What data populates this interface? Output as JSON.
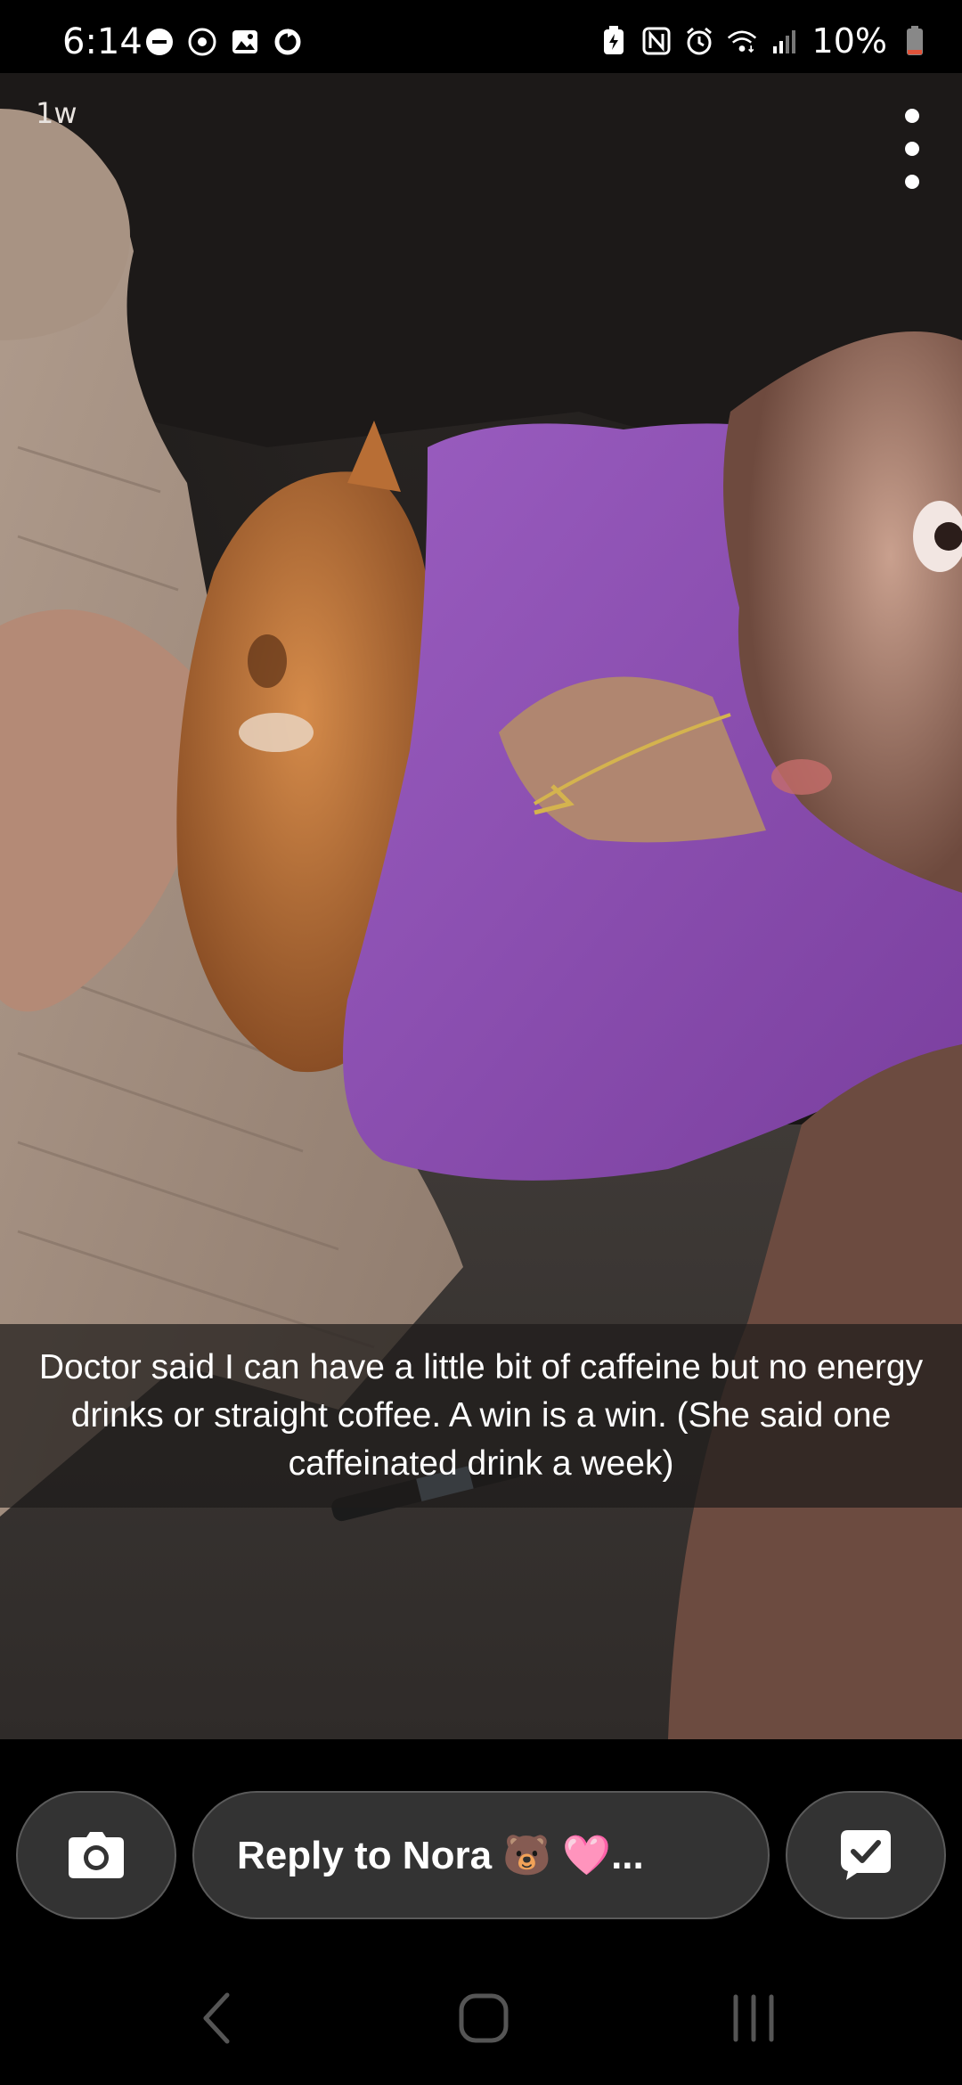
{
  "status_bar": {
    "time": "6:14",
    "battery_percent": "10%",
    "left_icons": [
      "do-not-disturb-icon",
      "location-sync-icon",
      "gallery-icon",
      "sync-icon"
    ],
    "right_icons": [
      "battery-saver-icon",
      "nfc-icon",
      "alarm-icon",
      "wifi-icon",
      "signal-icon",
      "battery-icon"
    ]
  },
  "story": {
    "age": "1w",
    "caption": "Doctor said I can have a little bit of caffeine but no energy drinks or straight coffee. A win is a win. (She said one caffeinated drink a week)"
  },
  "bottom_bar": {
    "reply_placeholder": "Reply to Nora 🐻 🩷..."
  },
  "colors": {
    "pill_bg": "#333333",
    "shirt": "#8e4fb0",
    "cat": "#c87a3c",
    "blanket": "#c9b7a8"
  },
  "nav": {
    "buttons": [
      "back-icon",
      "home-icon",
      "recents-icon"
    ]
  }
}
